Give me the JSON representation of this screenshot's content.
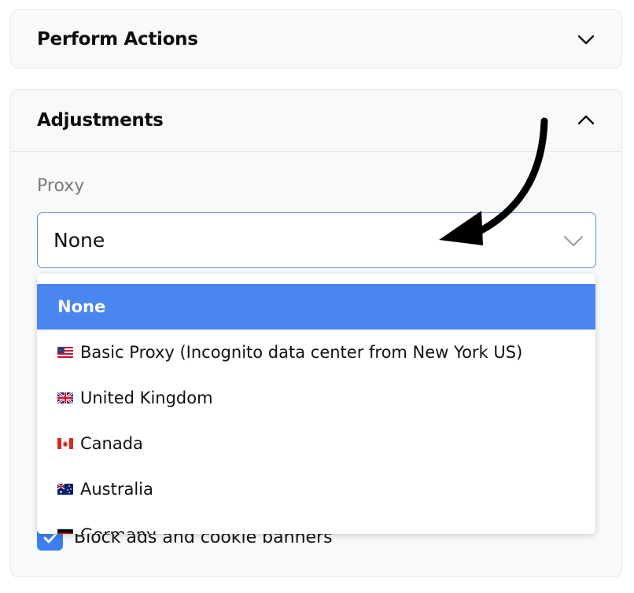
{
  "sections": {
    "perform": {
      "title": "Perform Actions",
      "icon": "chevron-down-icon"
    },
    "adjust": {
      "title": "Adjustments",
      "icon": "chevron-up-icon"
    }
  },
  "proxy": {
    "label": "Proxy",
    "selected": "None",
    "icon": "chevron-down-icon"
  },
  "dropdown": {
    "options": [
      {
        "label": "None",
        "flag": ""
      },
      {
        "label": "Basic Proxy (Incognito data center from New York US)",
        "flag": "us-flag-icon"
      },
      {
        "label": "United Kingdom",
        "flag": "uk-flag-icon"
      },
      {
        "label": "Canada",
        "flag": "canada-flag-icon"
      },
      {
        "label": "Australia",
        "flag": "australia-flag-icon"
      },
      {
        "label": "Germany",
        "flag": "germany-flag-icon"
      }
    ]
  },
  "checkbox": {
    "label": "Block ads and cookie banners",
    "checked": true
  },
  "colors": {
    "accent": "#4a86f0",
    "border_focus": "#5a8be8",
    "card_bg": "#f8f9fb"
  }
}
